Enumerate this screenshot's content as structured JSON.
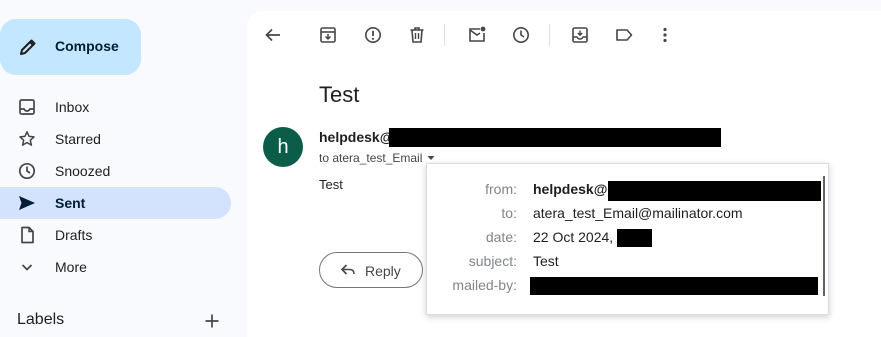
{
  "sidebar": {
    "compose_label": "Compose",
    "items": [
      {
        "label": "Inbox",
        "icon": "inbox-icon"
      },
      {
        "label": "Starred",
        "icon": "star-icon"
      },
      {
        "label": "Snoozed",
        "icon": "clock-icon"
      },
      {
        "label": "Sent",
        "icon": "send-icon",
        "active": true
      },
      {
        "label": "Drafts",
        "icon": "draft-icon"
      },
      {
        "label": "More",
        "icon": "chevron-down-icon"
      }
    ],
    "labels_heading": "Labels"
  },
  "toolbar": {
    "icons": [
      "back-arrow-icon",
      "archive-icon",
      "report-spam-icon",
      "delete-icon",
      "mark-unread-icon",
      "snooze-icon",
      "move-to-icon",
      "label-icon",
      "more-vert-icon"
    ]
  },
  "message": {
    "subject": "Test",
    "avatar_letter": "h",
    "sender_prefix": "helpdesk@",
    "to_line": "to atera_test_Email",
    "body": "Test",
    "reply_label": "Reply"
  },
  "details": {
    "from_key": "from:",
    "from_prefix": "helpdesk@",
    "to_key": "to:",
    "to_value": "atera_test_Email@mailinator.com",
    "date_key": "date:",
    "date_value": "22 Oct 2024,",
    "subject_key": "subject:",
    "subject_value": "Test",
    "mailedby_key": "mailed-by:"
  },
  "colors": {
    "compose_bg": "#c2e7ff",
    "active_nav_bg": "#d3e3fd",
    "avatar_bg": "#0b5d4a",
    "page_bg": "#f8fafd"
  }
}
